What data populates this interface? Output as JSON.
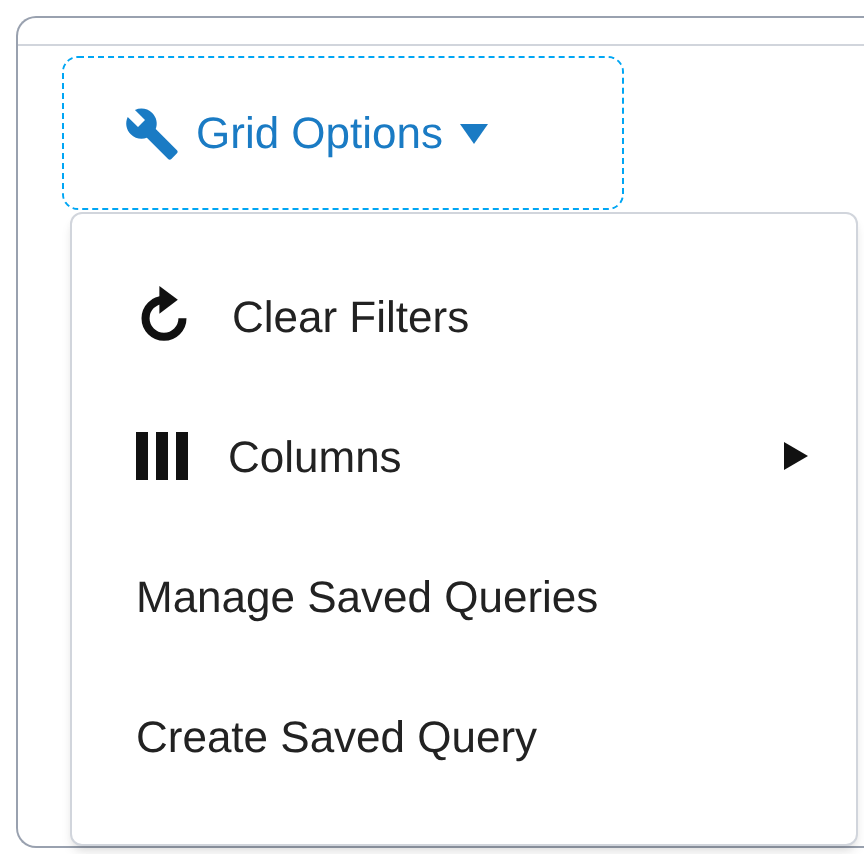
{
  "button": {
    "label": "Grid Options"
  },
  "menu": {
    "items": [
      {
        "kind": "refresh",
        "label": "Clear Filters",
        "submenu": false
      },
      {
        "kind": "columns",
        "label": "Columns",
        "submenu": true
      },
      {
        "kind": "plain",
        "label": "Manage Saved Queries",
        "submenu": false
      },
      {
        "kind": "plain",
        "label": "Create Saved Query",
        "submenu": false
      }
    ]
  }
}
